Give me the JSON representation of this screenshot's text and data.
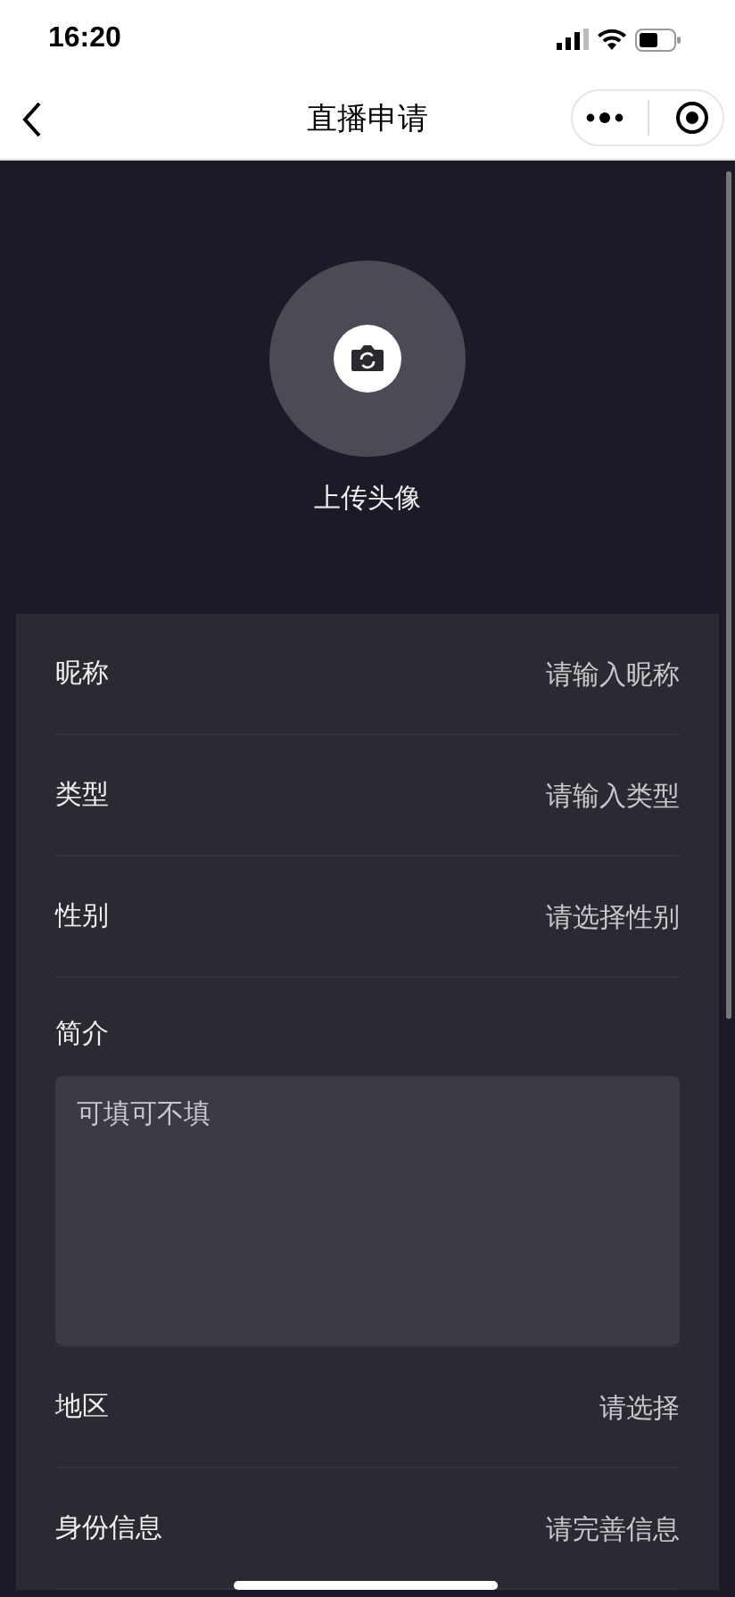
{
  "status_bar": {
    "time": "16:20"
  },
  "nav": {
    "title": "直播申请"
  },
  "avatar": {
    "label": "上传头像"
  },
  "fields": [
    {
      "kind": "input",
      "label": "昵称",
      "placeholder": "请输入昵称"
    },
    {
      "kind": "input",
      "label": "类型",
      "placeholder": "请输入类型"
    },
    {
      "kind": "input",
      "label": "性别",
      "placeholder": "请选择性别"
    },
    {
      "kind": "textarea",
      "label": "简介",
      "placeholder": "可填可不填"
    },
    {
      "kind": "input",
      "label": "地区",
      "placeholder": "请选择"
    },
    {
      "kind": "input",
      "label": "身份信息",
      "placeholder": "请完善信息"
    }
  ]
}
